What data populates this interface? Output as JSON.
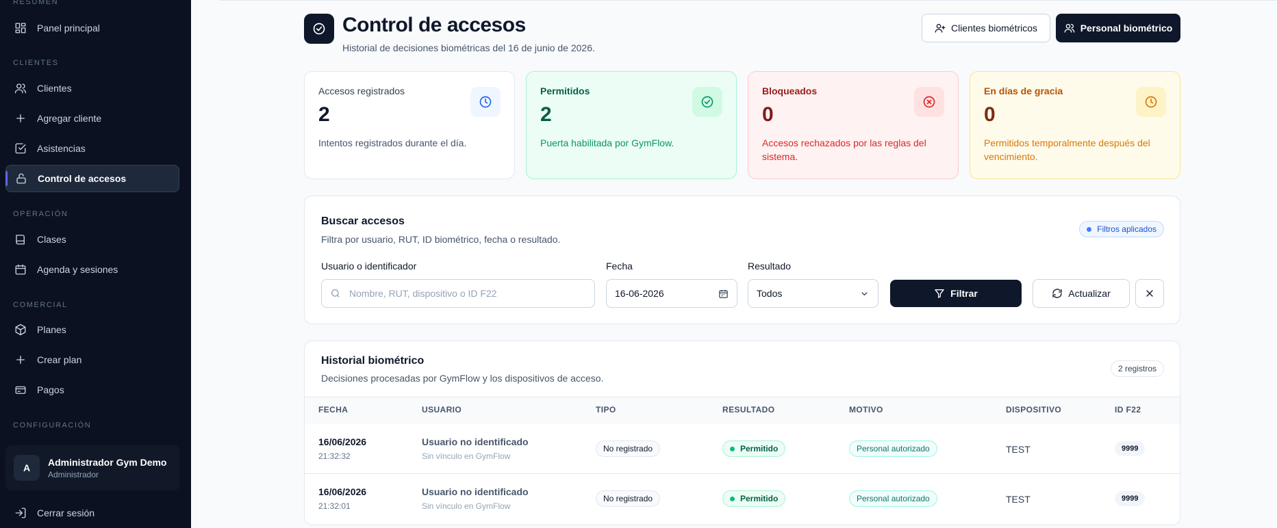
{
  "sidebar": {
    "sections": {
      "resumen": "RESUMEN",
      "clientes": "CLIENTES",
      "operacion": "OPERACIÓN",
      "comercial": "COMERCIAL",
      "configuracion": "CONFIGURACIÓN"
    },
    "items": [
      {
        "label": "Panel principal",
        "icon": "dashboard-icon"
      },
      {
        "label": "Clientes",
        "icon": "users-icon"
      },
      {
        "label": "Agregar cliente",
        "icon": "plus-icon"
      },
      {
        "label": "Asistencias",
        "icon": "checkbox-icon"
      },
      {
        "label": "Control de accesos",
        "icon": "lock-icon",
        "active": true
      },
      {
        "label": "Clases",
        "icon": "book-icon"
      },
      {
        "label": "Agenda y sesiones",
        "icon": "calendar-icon"
      },
      {
        "label": "Planes",
        "icon": "box-icon"
      },
      {
        "label": "Crear plan",
        "icon": "plus-icon"
      },
      {
        "label": "Pagos",
        "icon": "card-icon"
      }
    ],
    "user": {
      "initial": "A",
      "name": "Administrador Gym Demo",
      "role": "Administrador"
    },
    "logout": "Cerrar sesión"
  },
  "header": {
    "title": "Control de accesos",
    "subtitle": "Historial de decisiones biométricas del 16 de junio de 2026.",
    "btn_clients": "Clientes biométricos",
    "btn_staff": "Personal biométrico"
  },
  "stats": [
    {
      "label": "Accesos registrados",
      "value": "2",
      "desc": "Intentos registrados durante el día.",
      "color": "#2563eb"
    },
    {
      "label": "Permitidos",
      "value": "2",
      "desc": "Puerta habilitada por GymFlow.",
      "color": "#059669"
    },
    {
      "label": "Bloqueados",
      "value": "0",
      "desc": "Accesos rechazados por las reglas del sistema.",
      "color": "#dc2626"
    },
    {
      "label": "En días de gracia",
      "value": "0",
      "desc": "Permitidos temporalmente después del vencimiento.",
      "color": "#d97706"
    }
  ],
  "search": {
    "title": "Buscar accesos",
    "subtitle": "Filtra por usuario, RUT, ID biométrico, fecha o resultado.",
    "badge": "Filtros aplicados",
    "user_label": "Usuario o identificador",
    "user_placeholder": "Nombre, RUT, dispositivo o ID F22",
    "date_label": "Fecha",
    "date_value": "16-06-2026",
    "result_label": "Resultado",
    "result_value": "Todos",
    "filter_btn": "Filtrar",
    "refresh_btn": "Actualizar"
  },
  "history": {
    "title": "Historial biométrico",
    "subtitle": "Decisiones procesadas por GymFlow y los dispositivos de acceso.",
    "count": "2 registros",
    "columns": [
      "FECHA",
      "USUARIO",
      "TIPO",
      "RESULTADO",
      "MOTIVO",
      "DISPOSITIVO",
      "ID F22"
    ],
    "rows": [
      {
        "date": "16/06/2026",
        "time": "21:32:32",
        "user": "Usuario no identificado",
        "user_sub": "Sin vínculo en GymFlow",
        "type": "No registrado",
        "result": "Permitido",
        "reason": "Personal autorizado",
        "device": "TEST",
        "id": "9999"
      },
      {
        "date": "16/06/2026",
        "time": "21:32:01",
        "user": "Usuario no identificado",
        "user_sub": "Sin vínculo en GymFlow",
        "type": "No registrado",
        "result": "Permitido",
        "reason": "Personal autorizado",
        "device": "TEST",
        "id": "9999"
      }
    ]
  }
}
